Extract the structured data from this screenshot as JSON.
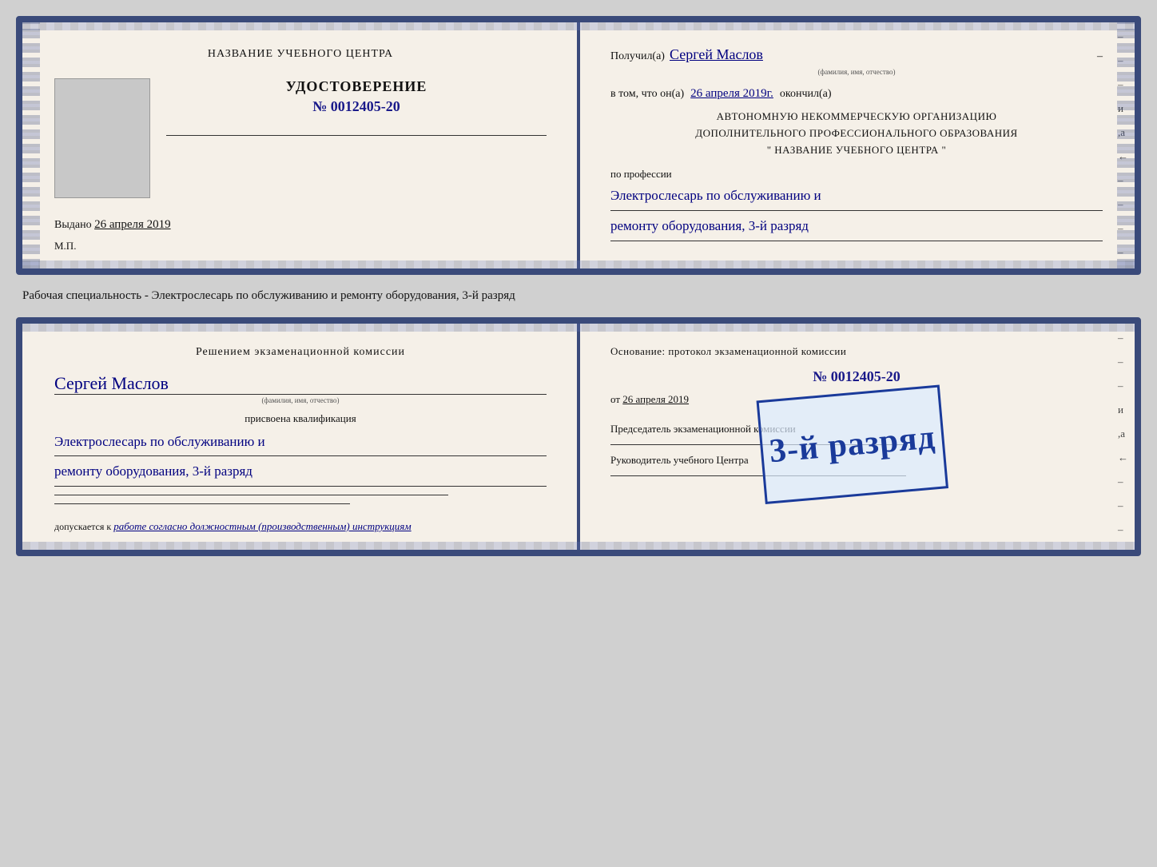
{
  "page": {
    "background": "#d0d0d0"
  },
  "cert1": {
    "left": {
      "org_name": "НАЗВАНИЕ УЧЕБНОГО ЦЕНТРА",
      "udostoverenie_label": "УДОСТОВЕРЕНИЕ",
      "number": "№ 0012405-20",
      "vydano_label": "Выдано",
      "vydano_date": "26 апреля 2019",
      "mp_label": "М.П."
    },
    "right": {
      "poluchil_label": "Получил(а)",
      "receiver_name": "Сергей Маслов",
      "fio_label": "(фамилия, имя, отчество)",
      "dash": "–",
      "vtom_label": "в том, что он(а)",
      "vtom_date": "26 апреля 2019г.",
      "okончил_label": "окончил(а)",
      "org_line1": "АВТОНОМНУЮ НЕКОММЕРЧЕСКУЮ ОРГАНИЗАЦИЮ",
      "org_line2": "ДОПОЛНИТЕЛЬНОГО ПРОФЕССИОНАЛЬНОГО ОБРАЗОВАНИЯ",
      "org_line3": "\"   НАЗВАНИЕ УЧЕБНОГО ЦЕНТРА   \"",
      "poprofessii_label": "по профессии",
      "profession_line1": "Электрослесарь по обслуживанию и",
      "profession_line2": "ремонту оборудования, 3-й разряд"
    }
  },
  "specialty_label": "Рабочая специальность - Электрослесарь по обслуживанию и ремонту оборудования, 3-й разряд",
  "cert2": {
    "left": {
      "heading": "Решением экзаменационной комиссии",
      "name": "Сергей Маслов",
      "fio_label": "(фамилия, имя, отчество)",
      "prisvoena_label": "присвоена квалификация",
      "qual_line1": "Электрослесарь по обслуживанию и",
      "qual_line2": "ремонту оборудования, 3-й разряд",
      "dopuskaetsya_label": "допускается к",
      "dopusk_text": "работе согласно должностным (производственным) инструкциям"
    },
    "right": {
      "osnovanie_label": "Основание: протокол экзаменационной комиссии",
      "number": "№  0012405-20",
      "ot_label": "от",
      "ot_date": "26 апреля 2019",
      "predsedatel_label": "Председатель экзаменационной комиссии",
      "rukovoditel_label": "Руководитель учебного Центра"
    },
    "stamp": {
      "text": "3-й разряд"
    }
  }
}
